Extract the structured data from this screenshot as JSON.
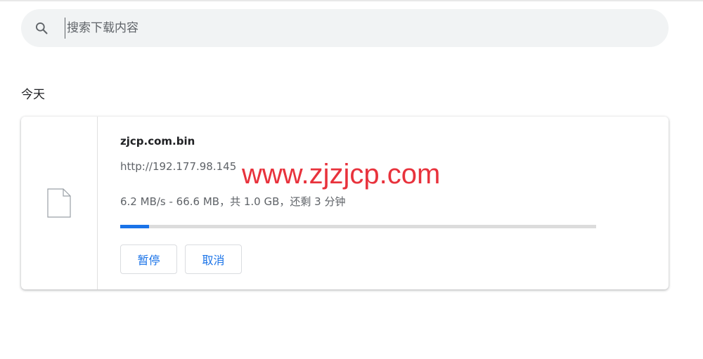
{
  "search": {
    "placeholder": "搜索下载内容",
    "icon": "search-icon"
  },
  "section": {
    "title": "今天"
  },
  "download": {
    "file_name": "zjcp.com.bin",
    "url": "http://192.177.98.145",
    "status": "6.2 MB/s - 66.6 MB，共 1.0 GB，还剩 3 分钟",
    "progress_percent": 6,
    "icon": "file-icon",
    "pause_label": "暂停",
    "cancel_label": "取消"
  },
  "watermark": {
    "text": "www.zjzjcp.com"
  },
  "colors": {
    "accent": "#1a73e8",
    "watermark": "#e8323c"
  }
}
